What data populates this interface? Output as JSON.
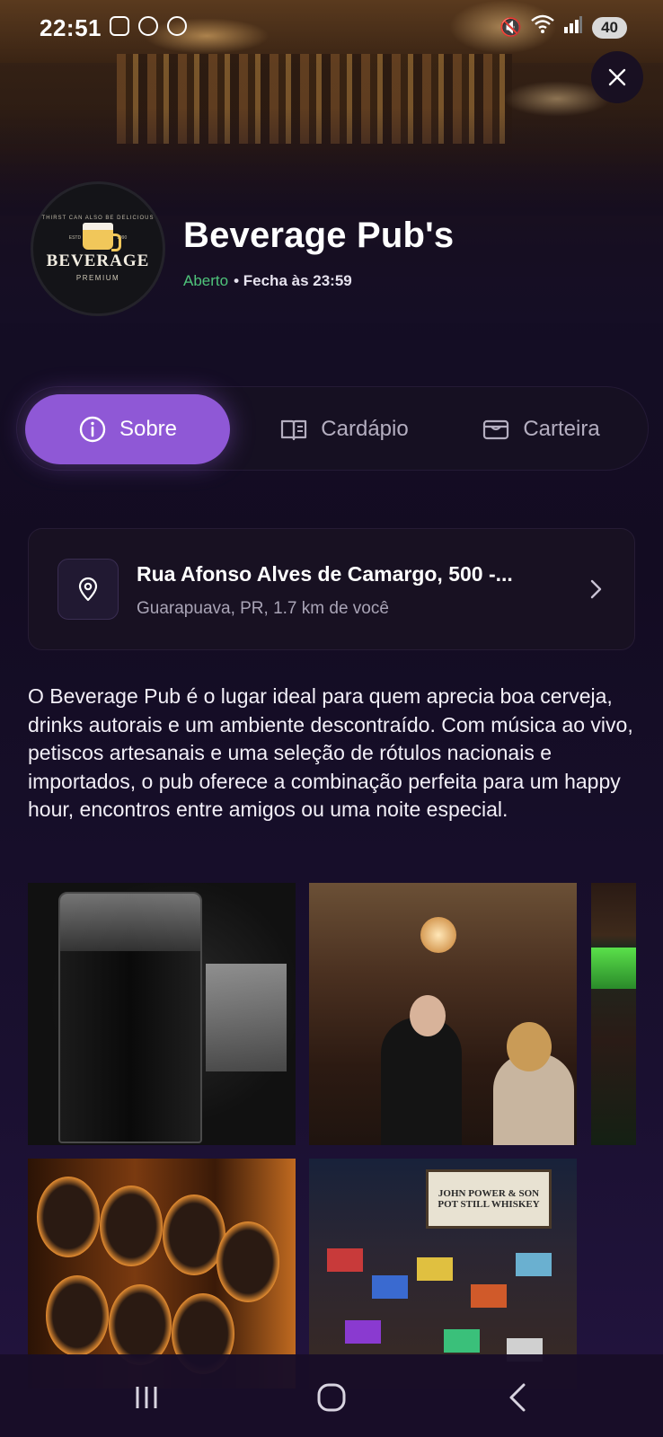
{
  "status_bar": {
    "time": "22:51",
    "battery": "40",
    "icons": [
      "screenshot-icon",
      "instagram-icon",
      "cloud-game-icon",
      "mute-icon",
      "wifi-icon",
      "signal-icon"
    ]
  },
  "venue": {
    "name": "Beverage Pub's",
    "status_open": "Aberto",
    "status_close": "• Fecha às 23:59",
    "logo": {
      "arc_text": "THIRST CAN ALSO BE DELICIOUS",
      "estd": "ESTD",
      "year": "1990",
      "word": "BEVERAGE",
      "sub": "PREMIUM"
    }
  },
  "tabs": [
    {
      "label": "Sobre",
      "icon": "info-icon",
      "active": true
    },
    {
      "label": "Cardápio",
      "icon": "menu-book-icon",
      "active": false
    },
    {
      "label": "Carteira",
      "icon": "wallet-icon",
      "active": false
    }
  ],
  "address": {
    "line1": "Rua Afonso Alves de Camargo, 500 -...",
    "line2": "Guarapuava, PR, 1.7 km de você"
  },
  "description": "O Beverage Pub é o lugar ideal para quem aprecia boa cerveja, drinks autorais e um ambiente descontraído. Com música ao vivo, petiscos artesanais e uma seleção de rótulos nacionais e importados, o pub oferece a combinação perfeita para um happy hour, encontros entre amigos ou uma noite especial.",
  "gallery": {
    "sign_text": "JOHN POWER & SON POT STILL WHISKEY"
  },
  "colors": {
    "accent": "#8f58d6",
    "open": "#4fc37a",
    "background": "#140d22"
  }
}
